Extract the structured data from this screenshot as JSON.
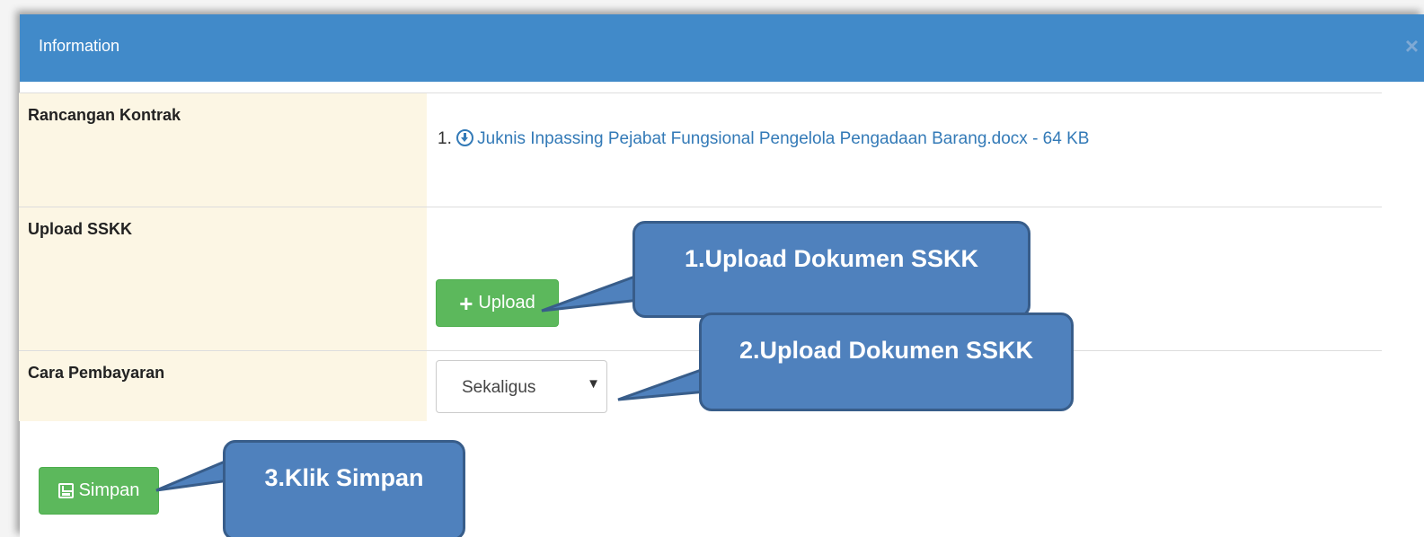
{
  "modal": {
    "title": "Information",
    "close_symbol": "×"
  },
  "rows": [
    {
      "label": "Rancangan Kontrak",
      "file_index": "1.",
      "file_link": "Juknis Inpassing Pejabat Fungsional Pengelola Pengadaan Barang.docx - 64 KB"
    },
    {
      "label": "Upload SSKK",
      "upload_button": "Upload"
    },
    {
      "label": "Cara Pembayaran",
      "select_value": "Sekaligus"
    }
  ],
  "save_button": "Simpan",
  "callouts": {
    "c1": "1.Upload Dokumen SSKK",
    "c2": "2.Upload Dokumen SSKK",
    "c3": "3.Klik Simpan"
  },
  "colors": {
    "header": "#418ac9",
    "label_bg": "#fcf6e4",
    "button_green": "#5cb85c",
    "callout_fill": "#4f81bd",
    "callout_border": "#385d8a"
  },
  "icons": {
    "download": "download-circle-icon",
    "plus": "plus-icon",
    "save": "floppy-disk-icon",
    "dropdown": "caret-down-icon",
    "close": "close-icon"
  }
}
